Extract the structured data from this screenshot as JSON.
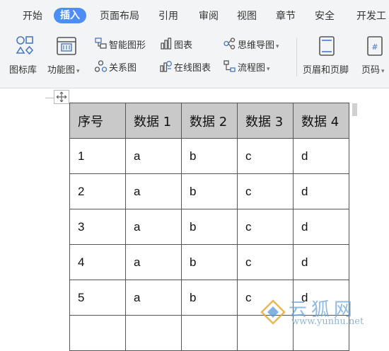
{
  "tabs": [
    "开始",
    "插入",
    "页面布局",
    "引用",
    "审阅",
    "视图",
    "章节",
    "安全",
    "开发工"
  ],
  "active_tab": "插入",
  "toolbar": {
    "icon_library": "图标库",
    "function_chart": "功能图",
    "smart_graphic": "智能图形",
    "chart": "图表",
    "mind_map": "思维导图",
    "relation_map": "关系图",
    "online_chart": "在线图表",
    "flowchart": "流程图",
    "header_footer": "页眉和页脚",
    "page_number": "页码"
  },
  "table": {
    "headers": [
      "序号",
      "数据 1",
      "数据 2",
      "数据 3",
      "数据 4"
    ],
    "rows": [
      [
        "1",
        "a",
        "b",
        "c",
        "d"
      ],
      [
        "2",
        "a",
        "b",
        "c",
        "d"
      ],
      [
        "3",
        "a",
        "b",
        "c",
        "d"
      ],
      [
        "4",
        "a",
        "b",
        "c",
        "d"
      ],
      [
        "5",
        "a",
        "b",
        "c",
        "d"
      ],
      [
        "",
        "",
        "",
        "",
        ""
      ]
    ]
  },
  "watermark": {
    "title": "云狐网",
    "url": "www.yunhu.net"
  }
}
